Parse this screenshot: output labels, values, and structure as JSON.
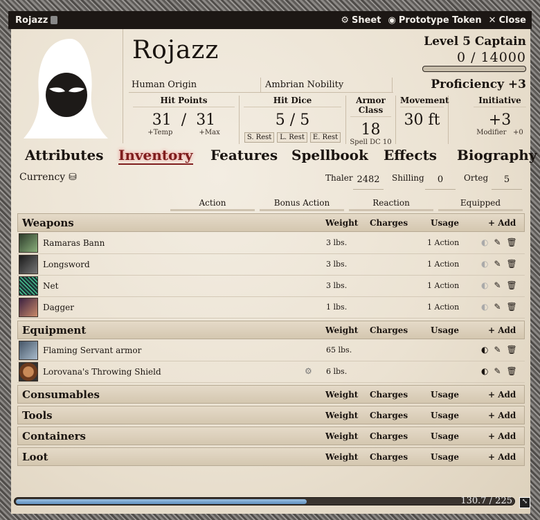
{
  "title": "Rojazz",
  "header_actions": {
    "sheet": "Sheet",
    "token": "Prototype Token",
    "close": "Close"
  },
  "char": {
    "name": "Rojazz",
    "level": "Level 5 Captain",
    "xp": "0 / 14000",
    "origin": "Human Origin",
    "background": "Ambrian Nobility",
    "proficiency": "Proficiency +3"
  },
  "stats": {
    "hp": {
      "label": "Hit Points",
      "value": "31",
      "max": "31",
      "temp": "+Temp",
      "maxlbl": "+Max"
    },
    "hd": {
      "label": "Hit Dice",
      "value": "5 / 5",
      "s": "S. Rest",
      "l": "L. Rest",
      "e": "E. Rest"
    },
    "ac": {
      "label": "Armor Class",
      "value": "18",
      "sub": "Spell DC 10"
    },
    "mv": {
      "label": "Movement",
      "value": "30 ft"
    },
    "init": {
      "label": "Initiative",
      "value": "+3",
      "mod": "Modifier",
      "modval": "+0"
    }
  },
  "tabs": [
    "Attributes",
    "Inventory",
    "Features",
    "Spellbook",
    "Effects",
    "Biography"
  ],
  "currency": {
    "label": "Currency",
    "thaler_label": "Thaler",
    "thaler": "2482",
    "shilling_label": "Shilling",
    "shilling": "0",
    "orteg_label": "Orteg",
    "orteg": "5"
  },
  "filters": [
    "Action",
    "Bonus Action",
    "Reaction",
    "Equipped"
  ],
  "cols": {
    "weight": "Weight",
    "charges": "Charges",
    "usage": "Usage",
    "add": "+ Add"
  },
  "sections": {
    "weapons": "Weapons",
    "equipment": "Equipment",
    "consumables": "Consumables",
    "tools": "Tools",
    "containers": "Containers",
    "loot": "Loot"
  },
  "weapons": [
    {
      "name": "Ramaras Bann",
      "weight": "3 lbs.",
      "usage": "1 Action"
    },
    {
      "name": "Longsword",
      "weight": "3 lbs.",
      "usage": "1 Action"
    },
    {
      "name": "Net",
      "weight": "3 lbs.",
      "usage": "1 Action"
    },
    {
      "name": "Dagger",
      "weight": "1 lbs.",
      "usage": "1 Action"
    }
  ],
  "equipment": [
    {
      "name": "Flaming Servant armor",
      "weight": "65 lbs."
    },
    {
      "name": "Lorovana's Throwing Shield",
      "weight": "6 lbs."
    }
  ],
  "encumbrance": {
    "text": "130.7 / 225",
    "fraction": 0.58
  }
}
